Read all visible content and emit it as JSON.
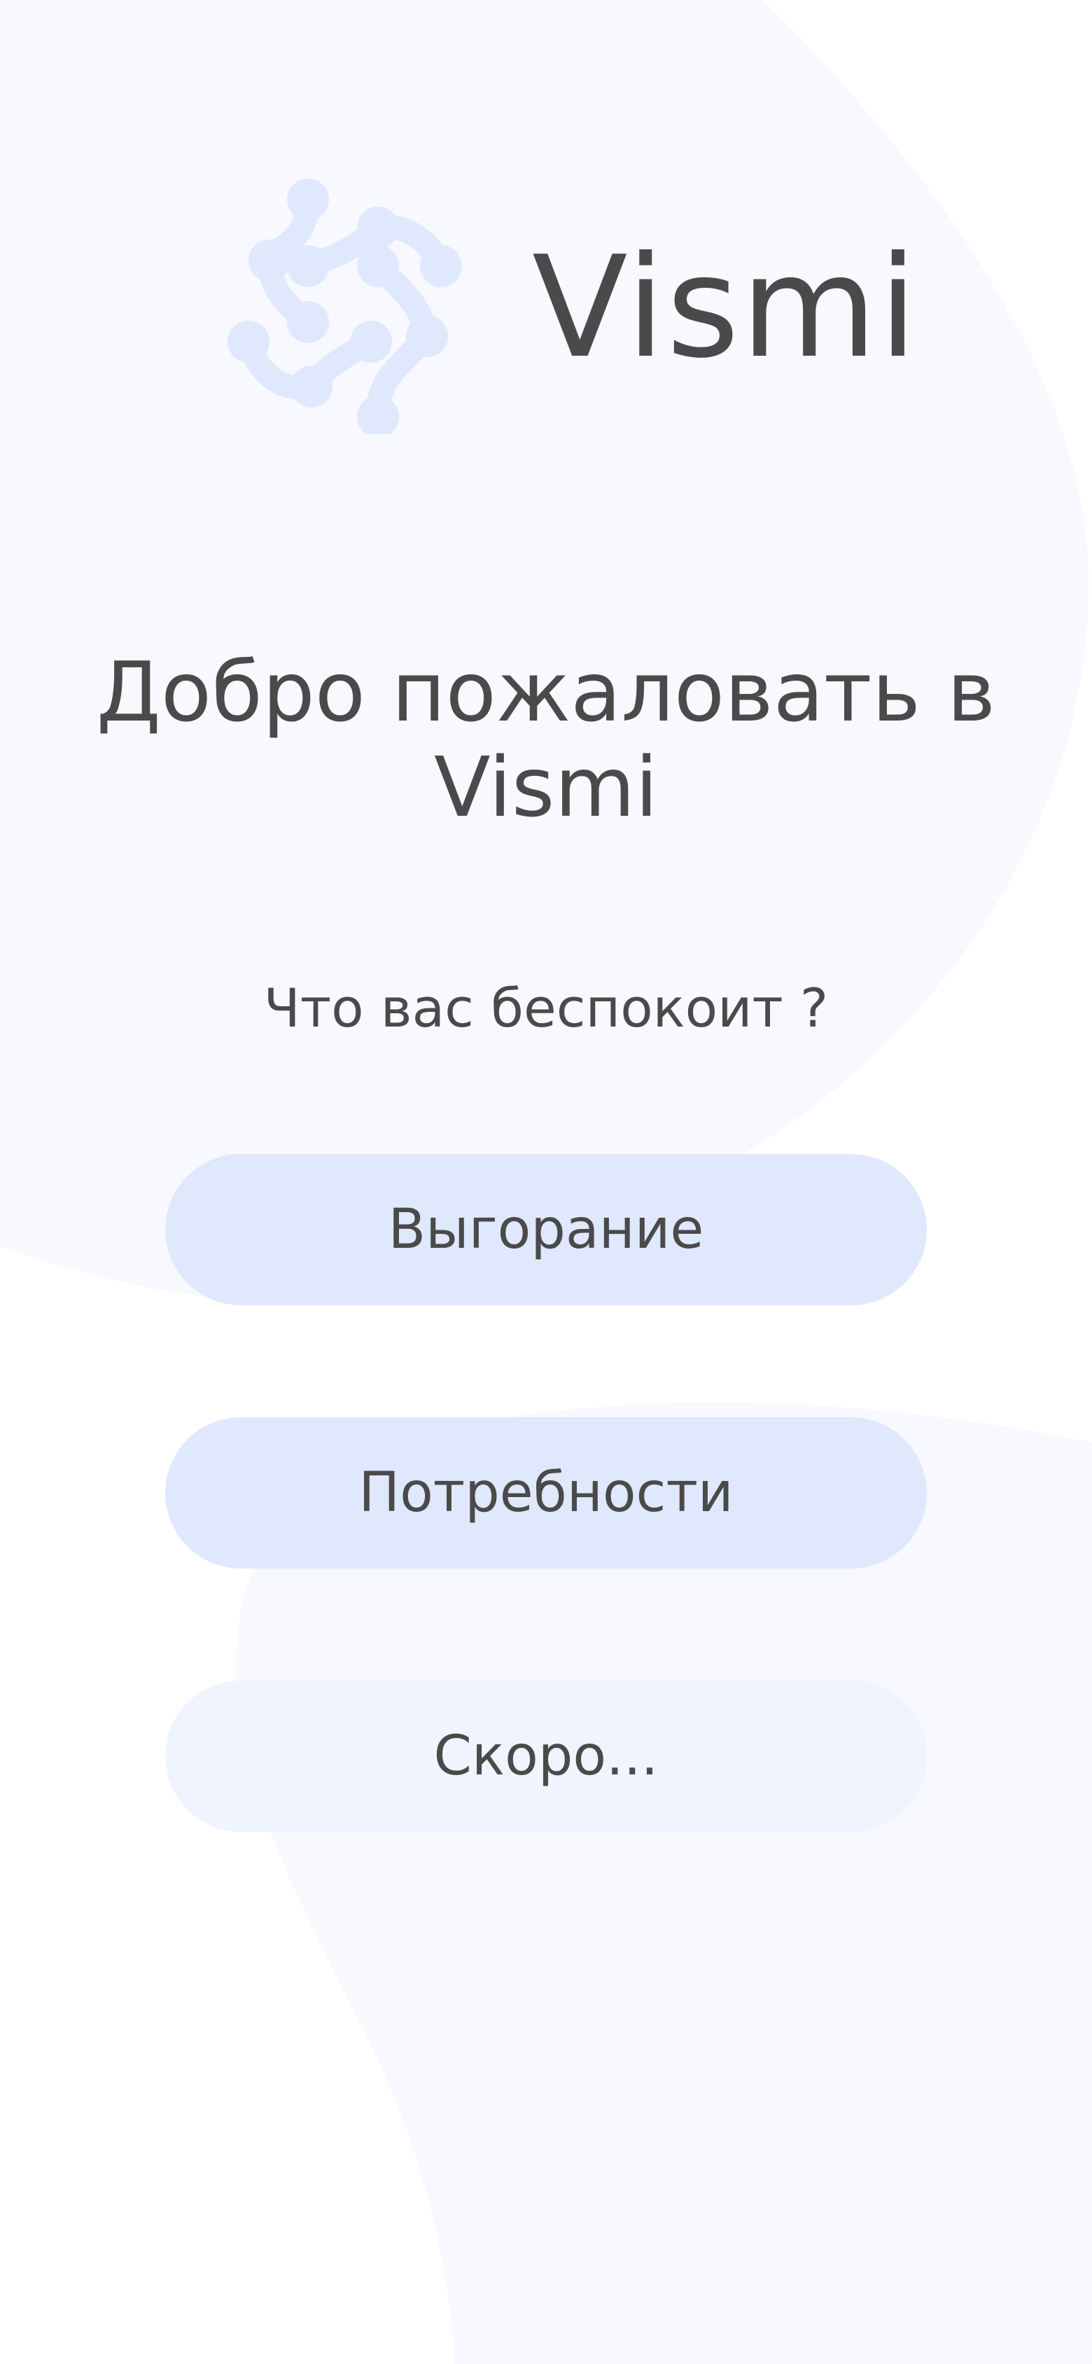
{
  "app": {
    "name": "Vismi",
    "logo_icon": "molecule-network-icon"
  },
  "welcome": {
    "line1": "Добро пожаловать в",
    "line2": "Vismi"
  },
  "question": "Что вас беспокоит ?",
  "options": [
    {
      "label": "Выгорание",
      "enabled": true
    },
    {
      "label": "Потребности",
      "enabled": true
    },
    {
      "label": "Скоро...",
      "enabled": false
    }
  ],
  "colors": {
    "background": "#ffffff",
    "background_shape": "#f7f9fe",
    "button": "#e0e8fd",
    "button_disabled": "#eff4fe",
    "logo": "#e0e8fd",
    "text": "#4a4a4a"
  }
}
